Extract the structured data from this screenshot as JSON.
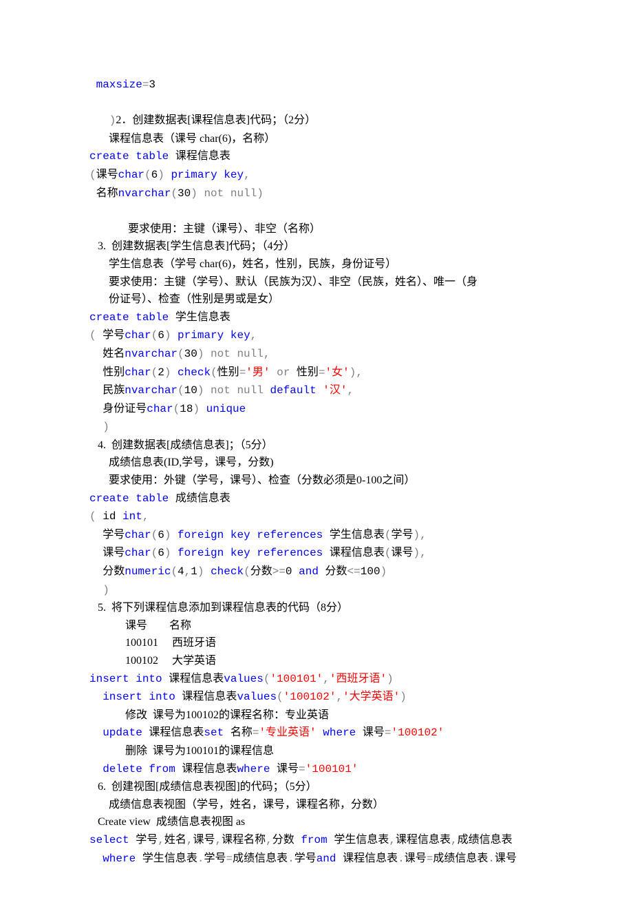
{
  "lines": [
    {
      "segs": [
        {
          "t": " maxsize",
          "c": "kw"
        },
        {
          "t": "=",
          "c": "gray"
        },
        {
          "t": "3",
          "c": "blk mono"
        }
      ]
    },
    {
      "segs": [
        {
          "t": " ",
          "c": "blk"
        }
      ]
    },
    {
      "segs": [
        {
          "t": "   )",
          "c": "gray"
        },
        {
          "t": "2．创建数据表[课程信息表]代码；（2分）",
          "c": "blk"
        }
      ]
    },
    {
      "segs": [
        {
          "t": "       课程信息表（课号 char(6)，名称）",
          "c": "blk"
        }
      ]
    },
    {
      "segs": [
        {
          "t": "create table",
          "c": "kw"
        },
        {
          "t": " 课程信息表",
          "c": "blk mono"
        }
      ]
    },
    {
      "segs": [
        {
          "t": "(",
          "c": "gray"
        },
        {
          "t": "课号",
          "c": "blk mono"
        },
        {
          "t": "char",
          "c": "kw"
        },
        {
          "t": "(",
          "c": "gray"
        },
        {
          "t": "6",
          "c": "blk mono"
        },
        {
          "t": ") ",
          "c": "gray"
        },
        {
          "t": "primary key",
          "c": "kw"
        },
        {
          "t": ",",
          "c": "gray"
        }
      ]
    },
    {
      "segs": [
        {
          "t": " 名称",
          "c": "blk mono"
        },
        {
          "t": "nvarchar",
          "c": "kw"
        },
        {
          "t": "(",
          "c": "gray"
        },
        {
          "t": "30",
          "c": "blk mono"
        },
        {
          "t": ") ",
          "c": "gray"
        },
        {
          "t": "not null",
          "c": "gray"
        },
        {
          "t": ")",
          "c": "gray"
        }
      ]
    },
    {
      "segs": [
        {
          "t": " ",
          "c": "blk"
        }
      ]
    },
    {
      "segs": [
        {
          "t": "              要求使用：主键（课号）、非空（名称）",
          "c": "blk"
        }
      ]
    },
    {
      "segs": [
        {
          "t": "   3.  创建数据表[学生信息表]代码；（4分）",
          "c": "blk"
        }
      ]
    },
    {
      "segs": [
        {
          "t": "       学生信息表（学号 char(6)，姓名，性别，民族，身份证号）",
          "c": "blk"
        }
      ]
    },
    {
      "segs": [
        {
          "t": "       要求使用：主键（学号）、默认（民族为汉）、非空（民族，姓名）、唯一（身",
          "c": "blk"
        }
      ]
    },
    {
      "segs": [
        {
          "t": "       份证号）、检查（性别是男或是女）",
          "c": "blk"
        }
      ]
    },
    {
      "segs": [
        {
          "t": "create table",
          "c": "kw"
        },
        {
          "t": " 学生信息表",
          "c": "blk mono"
        }
      ]
    },
    {
      "segs": [
        {
          "t": "(",
          "c": "gray"
        },
        {
          "t": " 学号",
          "c": "blk mono"
        },
        {
          "t": "char",
          "c": "kw"
        },
        {
          "t": "(",
          "c": "gray"
        },
        {
          "t": "6",
          "c": "blk mono"
        },
        {
          "t": ") ",
          "c": "gray"
        },
        {
          "t": "primary key",
          "c": "kw"
        },
        {
          "t": ",",
          "c": "gray"
        }
      ]
    },
    {
      "segs": [
        {
          "t": "  姓名",
          "c": "blk mono"
        },
        {
          "t": "nvarchar",
          "c": "kw"
        },
        {
          "t": "(",
          "c": "gray"
        },
        {
          "t": "30",
          "c": "blk mono"
        },
        {
          "t": ") ",
          "c": "gray"
        },
        {
          "t": "not null",
          "c": "gray"
        },
        {
          "t": ",",
          "c": "gray"
        }
      ]
    },
    {
      "segs": [
        {
          "t": "  性别",
          "c": "blk mono"
        },
        {
          "t": "char",
          "c": "kw"
        },
        {
          "t": "(",
          "c": "gray"
        },
        {
          "t": "2",
          "c": "blk mono"
        },
        {
          "t": ") ",
          "c": "gray"
        },
        {
          "t": "check",
          "c": "kw"
        },
        {
          "t": "(",
          "c": "gray"
        },
        {
          "t": "性别",
          "c": "blk mono"
        },
        {
          "t": "=",
          "c": "gray"
        },
        {
          "t": "'男'",
          "c": "str"
        },
        {
          "t": " or ",
          "c": "gray"
        },
        {
          "t": "性别",
          "c": "blk mono"
        },
        {
          "t": "=",
          "c": "gray"
        },
        {
          "t": "'女'",
          "c": "str"
        },
        {
          "t": "),",
          "c": "gray"
        }
      ]
    },
    {
      "segs": [
        {
          "t": "  民族",
          "c": "blk mono"
        },
        {
          "t": "nvarchar",
          "c": "kw"
        },
        {
          "t": "(",
          "c": "gray"
        },
        {
          "t": "10",
          "c": "blk mono"
        },
        {
          "t": ") ",
          "c": "gray"
        },
        {
          "t": "not null ",
          "c": "gray"
        },
        {
          "t": "default ",
          "c": "kw"
        },
        {
          "t": "'汉'",
          "c": "str"
        },
        {
          "t": ",",
          "c": "gray"
        }
      ]
    },
    {
      "segs": [
        {
          "t": "  身份证号",
          "c": "blk mono"
        },
        {
          "t": "char",
          "c": "kw"
        },
        {
          "t": "(",
          "c": "gray"
        },
        {
          "t": "18",
          "c": "blk mono"
        },
        {
          "t": ") ",
          "c": "gray"
        },
        {
          "t": "unique",
          "c": "kw"
        }
      ]
    },
    {
      "segs": [
        {
          "t": "  )",
          "c": "gray"
        }
      ]
    },
    {
      "segs": [
        {
          "t": "   4.  创建数据表[成绩信息表]；（5分）",
          "c": "blk"
        }
      ]
    },
    {
      "segs": [
        {
          "t": "       成绩信息表(ID,学号，课号，分数)",
          "c": "blk"
        }
      ]
    },
    {
      "segs": [
        {
          "t": "       要求使用：外键（学号，课号）、检查（分数必须是0-100之间）",
          "c": "blk"
        }
      ]
    },
    {
      "segs": [
        {
          "t": "create table",
          "c": "kw"
        },
        {
          "t": " 成绩信息表",
          "c": "blk mono"
        }
      ]
    },
    {
      "segs": [
        {
          "t": "(",
          "c": "gray"
        },
        {
          "t": " id ",
          "c": "blk mono"
        },
        {
          "t": "int",
          "c": "kw"
        },
        {
          "t": ",",
          "c": "gray"
        }
      ]
    },
    {
      "segs": [
        {
          "t": "  学号",
          "c": "blk mono"
        },
        {
          "t": "char",
          "c": "kw"
        },
        {
          "t": "(",
          "c": "gray"
        },
        {
          "t": "6",
          "c": "blk mono"
        },
        {
          "t": ") ",
          "c": "gray"
        },
        {
          "t": "foreign key references",
          "c": "kw"
        },
        {
          "t": " 学生信息表",
          "c": "blk mono"
        },
        {
          "t": "(",
          "c": "gray"
        },
        {
          "t": "学号",
          "c": "blk mono"
        },
        {
          "t": "),",
          "c": "gray"
        }
      ]
    },
    {
      "segs": [
        {
          "t": "  课号",
          "c": "blk mono"
        },
        {
          "t": "char",
          "c": "kw"
        },
        {
          "t": "(",
          "c": "gray"
        },
        {
          "t": "6",
          "c": "blk mono"
        },
        {
          "t": ") ",
          "c": "gray"
        },
        {
          "t": "foreign key references",
          "c": "kw"
        },
        {
          "t": " 课程信息表",
          "c": "blk mono"
        },
        {
          "t": "(",
          "c": "gray"
        },
        {
          "t": "课号",
          "c": "blk mono"
        },
        {
          "t": "),",
          "c": "gray"
        }
      ]
    },
    {
      "segs": [
        {
          "t": "  分数",
          "c": "blk mono"
        },
        {
          "t": "numeric",
          "c": "kw"
        },
        {
          "t": "(",
          "c": "gray"
        },
        {
          "t": "4",
          "c": "blk mono"
        },
        {
          "t": ",",
          "c": "gray"
        },
        {
          "t": "1",
          "c": "blk mono"
        },
        {
          "t": ") ",
          "c": "gray"
        },
        {
          "t": "check",
          "c": "kw"
        },
        {
          "t": "(",
          "c": "gray"
        },
        {
          "t": "分数",
          "c": "blk mono"
        },
        {
          "t": ">=",
          "c": "gray"
        },
        {
          "t": "0 ",
          "c": "blk mono"
        },
        {
          "t": "and",
          "c": "kw"
        },
        {
          "t": " 分数",
          "c": "blk mono"
        },
        {
          "t": "<=",
          "c": "gray"
        },
        {
          "t": "100",
          "c": "blk mono"
        },
        {
          "t": ")",
          "c": "gray"
        }
      ]
    },
    {
      "segs": [
        {
          "t": "  )",
          "c": "gray"
        }
      ]
    },
    {
      "segs": [
        {
          "t": "   5.  将下列课程信息添加到课程信息表的代码（8分）",
          "c": "blk"
        }
      ]
    },
    {
      "segs": [
        {
          "t": "             课号        名称",
          "c": "blk"
        }
      ]
    },
    {
      "segs": [
        {
          "t": "             100101     西班牙语",
          "c": "blk"
        }
      ]
    },
    {
      "segs": [
        {
          "t": "             100102     大学英语",
          "c": "blk"
        }
      ]
    },
    {
      "segs": [
        {
          "t": "insert into",
          "c": "kw"
        },
        {
          "t": " 课程信息表",
          "c": "blk mono"
        },
        {
          "t": "values",
          "c": "kw"
        },
        {
          "t": "(",
          "c": "gray"
        },
        {
          "t": "'100101'",
          "c": "str"
        },
        {
          "t": ",",
          "c": "gray"
        },
        {
          "t": "'西班牙语'",
          "c": "str"
        },
        {
          "t": ")",
          "c": "gray"
        }
      ]
    },
    {
      "segs": [
        {
          "t": "  insert into",
          "c": "kw"
        },
        {
          "t": " 课程信息表",
          "c": "blk mono"
        },
        {
          "t": "values",
          "c": "kw"
        },
        {
          "t": "(",
          "c": "gray"
        },
        {
          "t": "'100102'",
          "c": "str"
        },
        {
          "t": ",",
          "c": "gray"
        },
        {
          "t": "'大学英语'",
          "c": "str"
        },
        {
          "t": ")",
          "c": "gray"
        }
      ]
    },
    {
      "segs": [
        {
          "t": "             修改  课号为100102的课程名称：专业英语",
          "c": "blk"
        }
      ]
    },
    {
      "segs": [
        {
          "t": "  update",
          "c": "kw"
        },
        {
          "t": " 课程信息表",
          "c": "blk mono"
        },
        {
          "t": "set",
          "c": "kw"
        },
        {
          "t": " 名称",
          "c": "blk mono"
        },
        {
          "t": "=",
          "c": "gray"
        },
        {
          "t": "'专业英语'",
          "c": "str"
        },
        {
          "t": " where",
          "c": "kw"
        },
        {
          "t": " 课号",
          "c": "blk mono"
        },
        {
          "t": "=",
          "c": "gray"
        },
        {
          "t": "'100102'",
          "c": "str"
        }
      ]
    },
    {
      "segs": [
        {
          "t": "             删除  课号为100101的课程信息",
          "c": "blk"
        }
      ]
    },
    {
      "segs": [
        {
          "t": "  delete from",
          "c": "kw"
        },
        {
          "t": " 课程信息表",
          "c": "blk mono"
        },
        {
          "t": "where",
          "c": "kw"
        },
        {
          "t": " 课号",
          "c": "blk mono"
        },
        {
          "t": "=",
          "c": "gray"
        },
        {
          "t": "'100101'",
          "c": "str"
        }
      ]
    },
    {
      "segs": [
        {
          "t": "   6.  创建视图[成绩信息表视图]的代码；（5分）",
          "c": "blk"
        }
      ]
    },
    {
      "segs": [
        {
          "t": "       成绩信息表视图（学号，姓名，课号，课程名称，分数）",
          "c": "blk"
        }
      ]
    },
    {
      "segs": [
        {
          "t": "   Create view  成绩信息表视图 as",
          "c": "blk"
        }
      ]
    },
    {
      "segs": [
        {
          "t": "select",
          "c": "kw"
        },
        {
          "t": " 学号",
          "c": "blk mono"
        },
        {
          "t": ",",
          "c": "gray"
        },
        {
          "t": "姓名",
          "c": "blk mono"
        },
        {
          "t": ",",
          "c": "gray"
        },
        {
          "t": "课号",
          "c": "blk mono"
        },
        {
          "t": ",",
          "c": "gray"
        },
        {
          "t": "课程名称",
          "c": "blk mono"
        },
        {
          "t": ",",
          "c": "gray"
        },
        {
          "t": "分数 ",
          "c": "blk mono"
        },
        {
          "t": "from",
          "c": "kw"
        },
        {
          "t": " 学生信息表",
          "c": "blk mono"
        },
        {
          "t": ",",
          "c": "gray"
        },
        {
          "t": "课程信息表",
          "c": "blk mono"
        },
        {
          "t": ",",
          "c": "gray"
        },
        {
          "t": "成绩信息表",
          "c": "blk mono"
        }
      ]
    },
    {
      "segs": [
        {
          "t": "  where",
          "c": "kw"
        },
        {
          "t": " 学生信息表",
          "c": "blk mono"
        },
        {
          "t": ".",
          "c": "gray"
        },
        {
          "t": "学号",
          "c": "blk mono"
        },
        {
          "t": "=",
          "c": "gray"
        },
        {
          "t": "成绩信息表",
          "c": "blk mono"
        },
        {
          "t": ".",
          "c": "gray"
        },
        {
          "t": "学号",
          "c": "blk mono"
        },
        {
          "t": "and",
          "c": "kw"
        },
        {
          "t": " 课程信息表",
          "c": "blk mono"
        },
        {
          "t": ".",
          "c": "gray"
        },
        {
          "t": "课号",
          "c": "blk mono"
        },
        {
          "t": "=",
          "c": "gray"
        },
        {
          "t": "成绩信息表",
          "c": "blk mono"
        },
        {
          "t": ".",
          "c": "gray"
        },
        {
          "t": "课号",
          "c": "blk mono"
        }
      ]
    }
  ]
}
